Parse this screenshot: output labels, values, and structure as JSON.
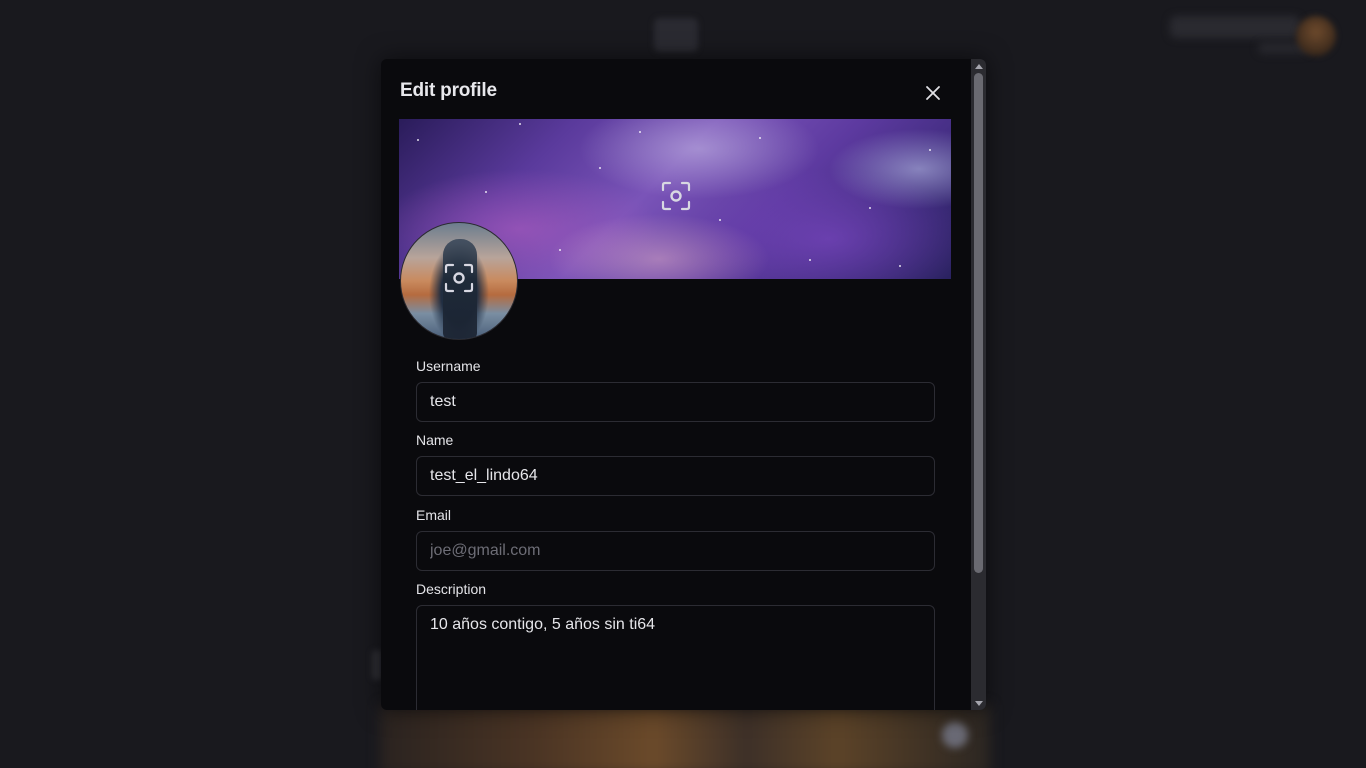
{
  "modal": {
    "title": "Edit profile",
    "close_icon": "close-icon"
  },
  "banner": {
    "upload_icon": "camera-focus-icon"
  },
  "avatar": {
    "upload_icon": "camera-focus-icon"
  },
  "form": {
    "username": {
      "label": "Username",
      "value": "test",
      "placeholder": ""
    },
    "name": {
      "label": "Name",
      "value": "test_el_lindo64",
      "placeholder": ""
    },
    "email": {
      "label": "Email",
      "value": "",
      "placeholder": "joe@gmail.com"
    },
    "description": {
      "label": "Description",
      "value": "10 años contigo, 5 años sin ti64",
      "placeholder": ""
    }
  },
  "colors": {
    "modal_bg": "#0a0a0d",
    "backdrop": "#19191e",
    "input_border": "#2c2c33",
    "text": "#e6e6ea",
    "placeholder": "#6d6d76"
  }
}
